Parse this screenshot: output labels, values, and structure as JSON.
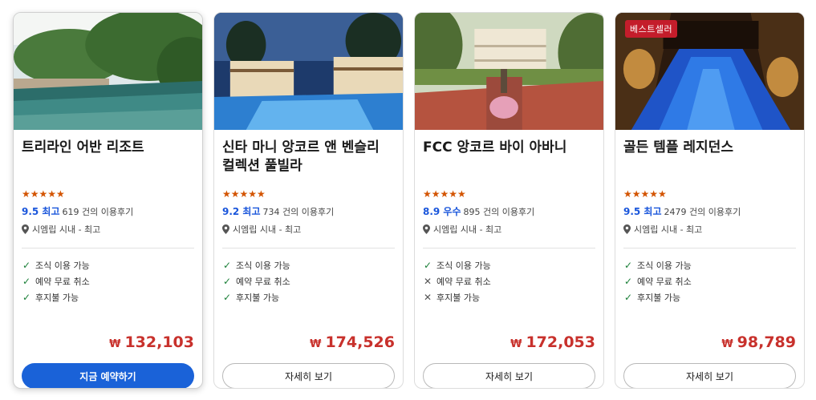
{
  "cards": [
    {
      "badge": "",
      "name": "트리라인 어반 리조트",
      "stars": "★★★★★",
      "score": "9.5 최고",
      "reviews": "619 건의 이용후기",
      "location": "시엠립 시내 - 최고",
      "features": [
        {
          "text": "조식 이용 가능",
          "available": true
        },
        {
          "text": "예약 무료 취소",
          "available": true
        },
        {
          "text": "후지불 가능",
          "available": true
        }
      ],
      "currency": "₩",
      "price": "132,103",
      "button": "지금 예약하기"
    },
    {
      "badge": "",
      "name": "신타 마니 앙코르 앤 벤슬리 컬렉션 풀빌라",
      "stars": "★★★★★",
      "score": "9.2 최고",
      "reviews": "734 건의 이용후기",
      "location": "시엠립 시내 - 최고",
      "features": [
        {
          "text": "조식 이용 가능",
          "available": true
        },
        {
          "text": "예약 무료 취소",
          "available": true
        },
        {
          "text": "후지불 가능",
          "available": true
        }
      ],
      "currency": "₩",
      "price": "174,526",
      "button": "자세히 보기"
    },
    {
      "badge": "",
      "name": "FCC 앙코르 바이 아바니",
      "stars": "★★★★★",
      "score": "8.9 우수",
      "reviews": "895 건의 이용후기",
      "location": "시엠립 시내 - 최고",
      "features": [
        {
          "text": "조식 이용 가능",
          "available": true
        },
        {
          "text": "예약 무료 취소",
          "available": false
        },
        {
          "text": "후지불 가능",
          "available": false
        }
      ],
      "currency": "₩",
      "price": "172,053",
      "button": "자세히 보기"
    },
    {
      "badge": "베스트셀러",
      "name": "골든 템플 레지던스",
      "stars": "★★★★★",
      "score": "9.5 최고",
      "reviews": "2479 건의 이용후기",
      "location": "시엠립 시내 - 최고",
      "features": [
        {
          "text": "조식 이용 가능",
          "available": true
        },
        {
          "text": "예약 무료 취소",
          "available": true
        },
        {
          "text": "후지불 가능",
          "available": true
        }
      ],
      "currency": "₩",
      "price": "98,789",
      "button": "자세히 보기"
    }
  ],
  "colors": {
    "score": "#1a56db",
    "price": "#c8312c",
    "stars": "#d35400",
    "primary_button": "#1a62d8",
    "badge": "#c41d2b",
    "check": "#1a7f37"
  },
  "icons": {
    "check": "✓",
    "cross": "✕",
    "location": "location-pin-icon"
  }
}
